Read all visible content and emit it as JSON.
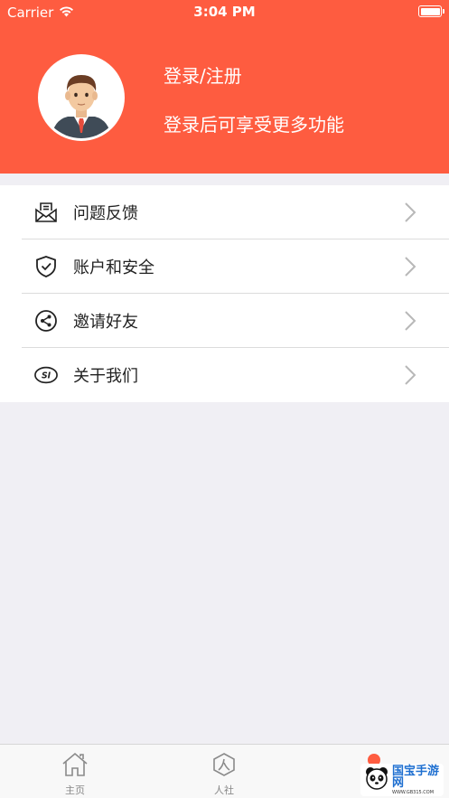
{
  "status_bar": {
    "carrier": "Carrier",
    "time": "3:04 PM"
  },
  "profile": {
    "title": "登录/注册",
    "subtitle": "登录后可享受更多功能"
  },
  "menu": {
    "items": [
      {
        "label": "问题反馈",
        "icon": "feedback-envelope-icon"
      },
      {
        "label": "账户和安全",
        "icon": "shield-check-icon"
      },
      {
        "label": "邀请好友",
        "icon": "share-icon"
      },
      {
        "label": "关于我们",
        "icon": "si-logo-icon"
      }
    ]
  },
  "tabbar": {
    "tabs": [
      {
        "label": "主页",
        "icon": "home-icon"
      },
      {
        "label": "人社",
        "icon": "person-hex-icon"
      },
      {
        "label": "",
        "icon": "badge-dot"
      }
    ]
  },
  "watermark": {
    "text": "国宝手游网",
    "sub": "WWW.GB315.COM"
  },
  "colors": {
    "header": "#fe5c40",
    "background": "#f0eff4"
  }
}
